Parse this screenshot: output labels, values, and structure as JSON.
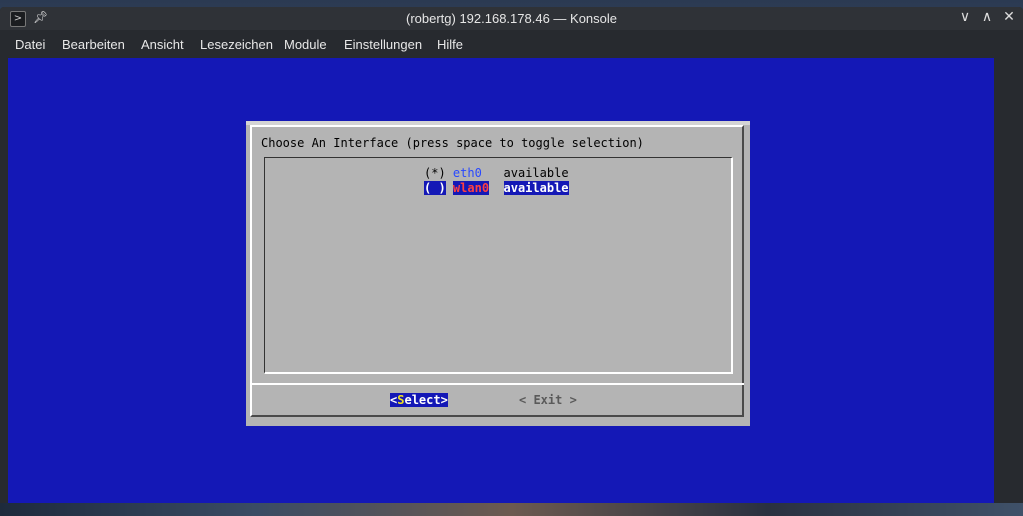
{
  "window": {
    "title": "(robertg) 192.168.178.46 — Konsole",
    "controls": {
      "minimize": "∨",
      "maximize": "∧",
      "close": "✕"
    }
  },
  "menu": [
    "Datei",
    "Bearbeiten",
    "Ansicht",
    "Lesezeichen",
    "Module",
    "Einstellungen",
    "Hilfe"
  ],
  "dialog": {
    "title": "Choose An Interface (press space to toggle selection)",
    "interfaces": [
      {
        "marker": "(*)",
        "name": "eth0",
        "status": "available",
        "selected": true,
        "focused": false
      },
      {
        "marker": "( )",
        "name": "wlan0",
        "status": "available",
        "selected": false,
        "focused": true
      }
    ],
    "buttons": {
      "select_open": "<",
      "select_hot": "S",
      "select_rest": "elect",
      "select_close": ">",
      "exit": "< Exit >"
    }
  },
  "colors": {
    "terminal_bg": "#1418b6",
    "dialog_bg": "#b4b4b4",
    "hotkey": "#f0e020",
    "eth_tag": "#2848ff",
    "wlan_tag": "#ff4040"
  },
  "icons": {
    "app": "terminal-icon",
    "pin": "pin-icon"
  }
}
